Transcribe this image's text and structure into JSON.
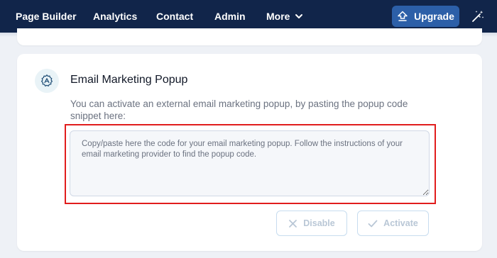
{
  "nav": {
    "items": [
      {
        "label": "Page Builder"
      },
      {
        "label": "Analytics"
      },
      {
        "label": "Contact"
      },
      {
        "label": "Admin"
      }
    ],
    "more_label": "More",
    "upgrade_label": "Upgrade"
  },
  "section": {
    "title": "Email Marketing Popup",
    "description": "You can activate an external email marketing popup, by pasting the popup code snippet here:",
    "textarea_value": "",
    "textarea_placeholder": "Copy/paste here the code for your email marketing popup. Follow the instructions of your email marketing provider to find the popup code.",
    "disable_label": "Disable",
    "activate_label": "Activate"
  },
  "colors": {
    "nav_background": "#11254a",
    "upgrade_button": "#2c5fa8",
    "highlight_border": "#e11d1d",
    "disabled_button_text": "#b9c7d6"
  },
  "icons": {
    "upgrade": "upload-arrow-icon",
    "tools": "magic-wand-icon",
    "section": "settings-gear-icon",
    "disable": "x-icon",
    "activate": "check-icon",
    "more": "chevron-down-icon"
  }
}
